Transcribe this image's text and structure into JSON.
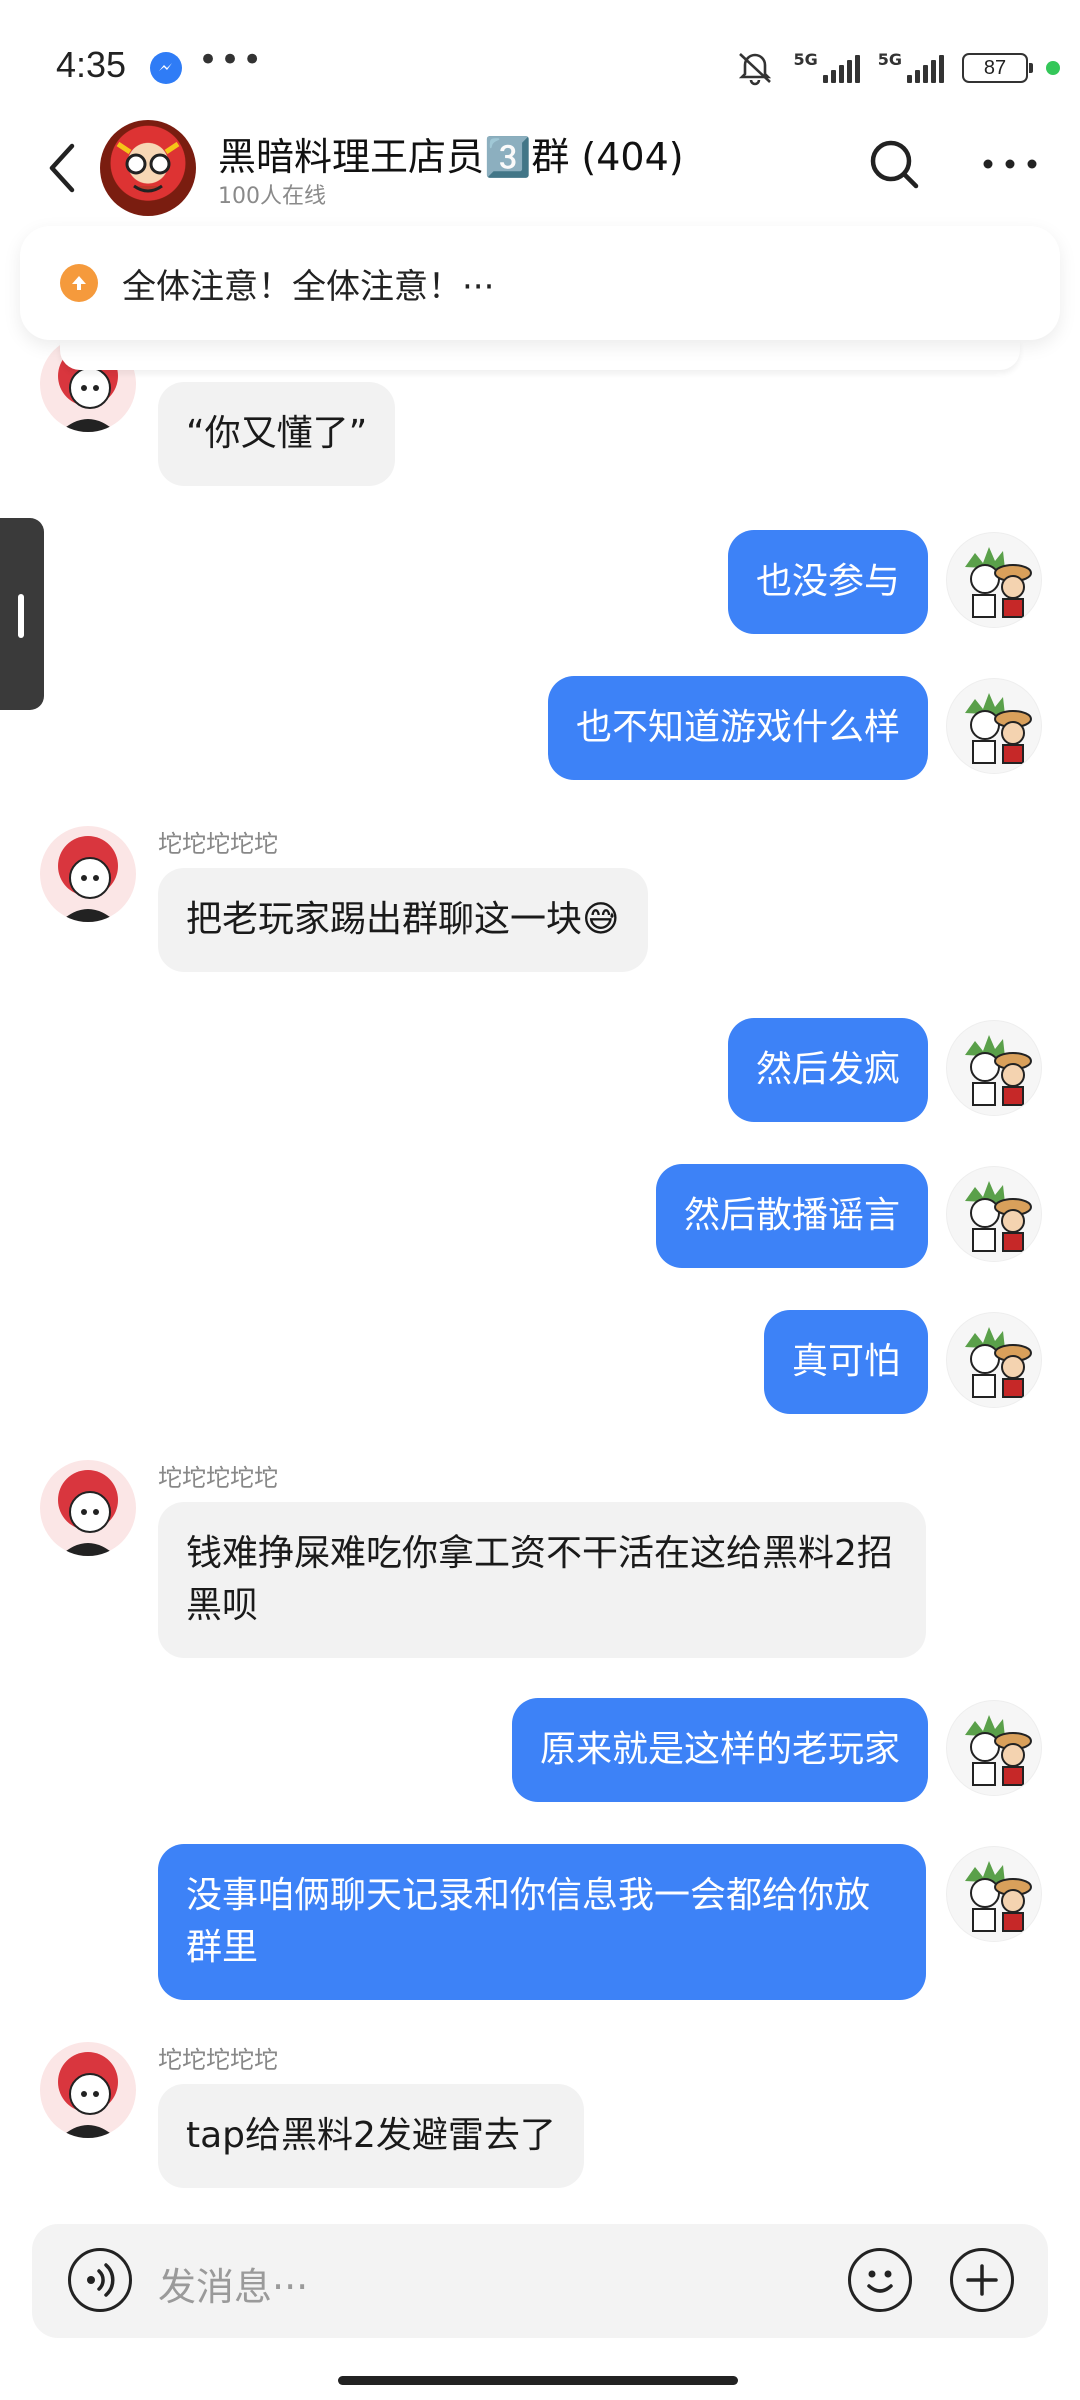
{
  "status_bar": {
    "time": "4:35",
    "net1": "5G",
    "net2": "5G",
    "battery": "87"
  },
  "header": {
    "title": "黑暗料理王店员3️⃣群 (404)",
    "subtitle": "100人在线"
  },
  "announcement": {
    "text": "全体注意！全体注意！···"
  },
  "messages": [
    {
      "side": "in",
      "nick": "",
      "text": "“你又懂了”"
    },
    {
      "side": "out",
      "text": "也没参与"
    },
    {
      "side": "out",
      "text": "也不知道游戏什么样"
    },
    {
      "side": "in",
      "nick": "坨坨坨坨坨",
      "text": "把老玩家踢出群聊这一块😅"
    },
    {
      "side": "out",
      "text": "然后发疯"
    },
    {
      "side": "out",
      "text": "然后散播谣言"
    },
    {
      "side": "out",
      "text": "真可怕"
    },
    {
      "side": "in",
      "nick": "坨坨坨坨坨",
      "text": "钱难挣屎难吃你拿工资不干活在这给黑料2招黑呗"
    },
    {
      "side": "out",
      "text": "原来就是这样的老玩家"
    },
    {
      "side": "out",
      "text": "没事咱俩聊天记录和你信息我一会都给你放群里"
    },
    {
      "side": "in",
      "nick": "坨坨坨坨坨",
      "text": "tap给黑料2发避雷去了"
    }
  ],
  "input": {
    "placeholder": "发消息···"
  },
  "colors": {
    "accent": "#3d82f7",
    "incoming": "#f2f2f2",
    "announce_icon": "#f59a3c"
  }
}
